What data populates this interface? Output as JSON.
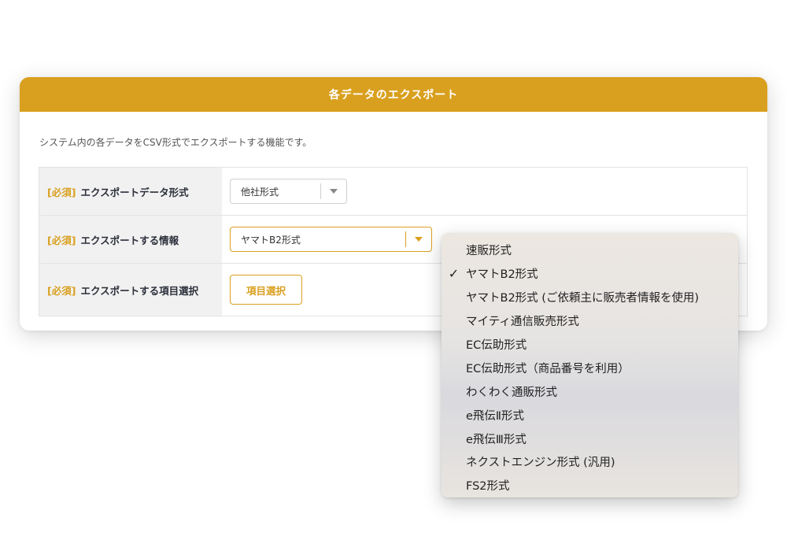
{
  "panel": {
    "title": "各データのエクスポート",
    "description": "システム内の各データをCSV形式でエクスポートする機能です。"
  },
  "form": {
    "required_tag": "[必須]",
    "rows": [
      {
        "label": "エクスポートデータ形式",
        "value": "他社形式"
      },
      {
        "label": "エクスポートする情報",
        "value": "ヤマトB2形式"
      },
      {
        "label": "エクスポートする項目選択",
        "button": "項目選択"
      }
    ]
  },
  "dropdown": {
    "selected_index": 1,
    "options": [
      "速販形式",
      "ヤマトB2形式",
      "ヤマトB2形式 (ご依頼主に販売者情報を使用)",
      "マイティ通信販売形式",
      "EC伝助形式",
      "EC伝助形式（商品番号を利用）",
      "わくわく通販形式",
      "e飛伝Ⅱ形式",
      "e飛伝Ⅲ形式",
      "ネクストエンジン形式 (汎用)",
      "FS2形式"
    ]
  },
  "colors": {
    "accent": "#d9a01f",
    "label_bg": "#f1f1f1"
  },
  "icons": {
    "checkmark": "check-icon",
    "select_arrow": "chevron-down-icon"
  }
}
